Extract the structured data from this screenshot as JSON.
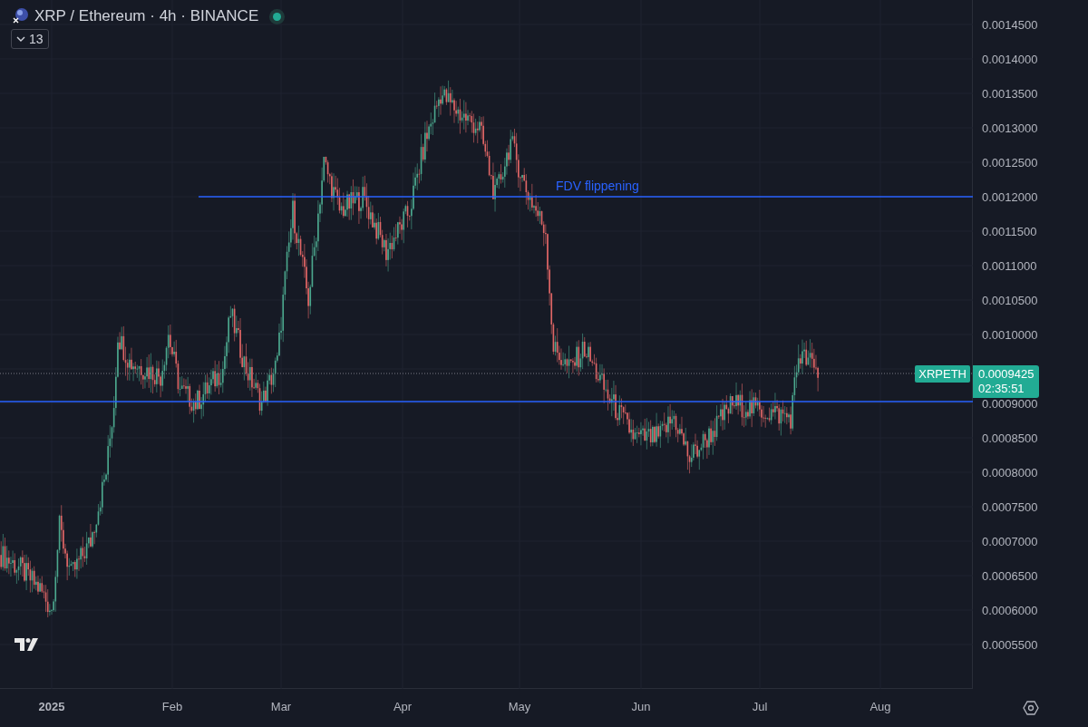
{
  "header": {
    "title": "XRP / Ethereum · 4h · BINANCE",
    "live": true,
    "indicators_toggle": {
      "count": "13",
      "expanded": false
    }
  },
  "price_axis": {
    "ticks": [
      "0.0014500",
      "0.0014000",
      "0.0013500",
      "0.0013000",
      "0.0012500",
      "0.0012000",
      "0.0011500",
      "0.0011000",
      "0.0010500",
      "0.0010000",
      "0.0009000",
      "0.0008500",
      "0.0008000",
      "0.0007500",
      "0.0007000",
      "0.0006500",
      "0.0006000",
      "0.0005500"
    ]
  },
  "time_axis": {
    "ticks": [
      {
        "label": "2025",
        "bold": true
      },
      {
        "label": "Feb",
        "bold": false
      },
      {
        "label": "Mar",
        "bold": false
      },
      {
        "label": "Apr",
        "bold": false
      },
      {
        "label": "May",
        "bold": false
      },
      {
        "label": "Jun",
        "bold": false
      },
      {
        "label": "Jul",
        "bold": false
      },
      {
        "label": "Aug",
        "bold": false
      }
    ]
  },
  "annotations": [
    {
      "label": "FDV flippening"
    }
  ],
  "last_price": {
    "symbol": "XRPETH",
    "price": "0.0009425",
    "countdown": "02:35:51"
  }
}
